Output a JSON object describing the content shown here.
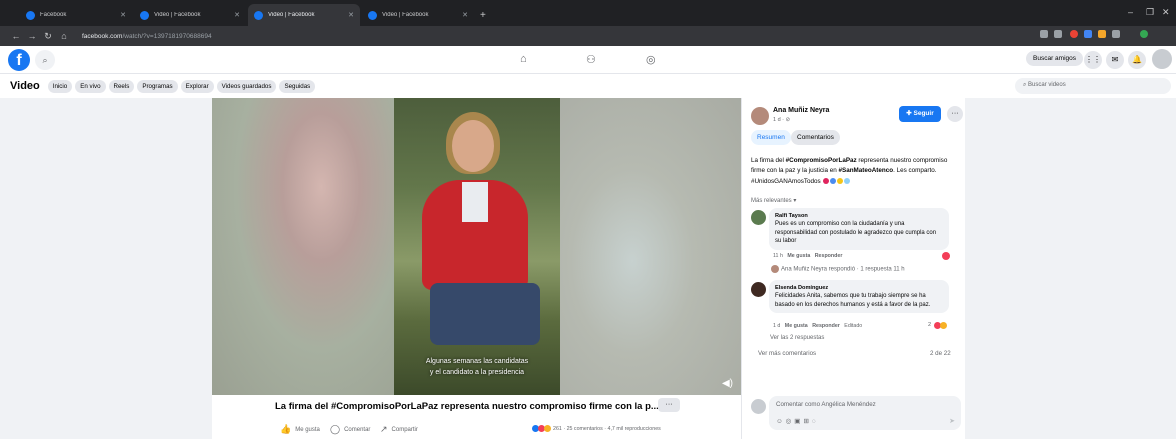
{
  "browser": {
    "tabs": [
      {
        "label": "Facebook",
        "active": false
      },
      {
        "label": "Video | Facebook",
        "active": false
      },
      {
        "label": "Video | Facebook",
        "active": true
      },
      {
        "label": "Video | Facebook",
        "active": false
      }
    ],
    "new_tab": "+",
    "url_host": "facebook.com",
    "url_path": "/watch/?v=1397181970688694"
  },
  "topnav": {
    "buscar_amigos": "Buscar amigos"
  },
  "videobar": {
    "title": "Video",
    "tabs": [
      "Inicio",
      "En vivo",
      "Reels",
      "Programas",
      "Explorar",
      "Videos guardados",
      "Seguidas"
    ],
    "search_placeholder": "Buscar videos"
  },
  "video": {
    "caption_line1": "Algunas semanas las candidatas",
    "caption_line2": "y el candidato a la presidencia",
    "title": "La firma del #CompromisoPorLaPaz representa nuestro compromiso firme con la p...",
    "more": "···",
    "actions": {
      "like": "Me gusta",
      "comment": "Comentar",
      "share": "Compartir"
    },
    "reaction_count": "261",
    "comments_count": "25 comentarios",
    "views": "4,7 mil reproducciones"
  },
  "panel": {
    "author": "Ana Muñiz Neyra",
    "time": "1 d · ⊘",
    "follow": "Seguir",
    "more": "···",
    "tab_summary": "Resumen",
    "tab_comments": "Comentarios",
    "desc_prefix": "La firma del ",
    "desc_hashtag1": "#CompromisoPorLaPaz",
    "desc_mid": " representa nuestro compromiso firme con la paz y la justicia en ",
    "desc_hashtag2": "#SanMateoAtenco",
    "desc_suffix": ". Les comparto.",
    "hashtags": "#UnidosGANAmosTodos",
    "relevance": "Más relevantes ▾",
    "comments": [
      {
        "name": "Ralfi Tayson",
        "text": "Pues es un compromiso con la ciudadanía y una responsabilidad con postulado le agradezco que cumpla con su labor",
        "time": "11 h",
        "like": "Me gusta",
        "reply": "Responder"
      },
      {
        "name": "Elsenda Domínguez",
        "text": "Felicidades Anita, sabemos que tu trabajo siempre se ha basado en los derechos humanos y está a favor de la paz.",
        "time": "1 d",
        "like": "Me gusta",
        "reply": "Responder",
        "edited": "Editado",
        "reactions": "2"
      }
    ],
    "author_replied": "Ana Muñiz Neyra respondió · 1 respuesta",
    "author_replied_time": "11 h",
    "see_replies": "Ver las 2 respuestas",
    "see_more": "Ver más comentarios",
    "paging": "2 de 22",
    "compose_placeholder": "Comentar como Angélica Menéndez"
  },
  "colors": {
    "brand": "#1877f2",
    "follow_button": "#1877f2",
    "jacket": "#c8262c"
  }
}
